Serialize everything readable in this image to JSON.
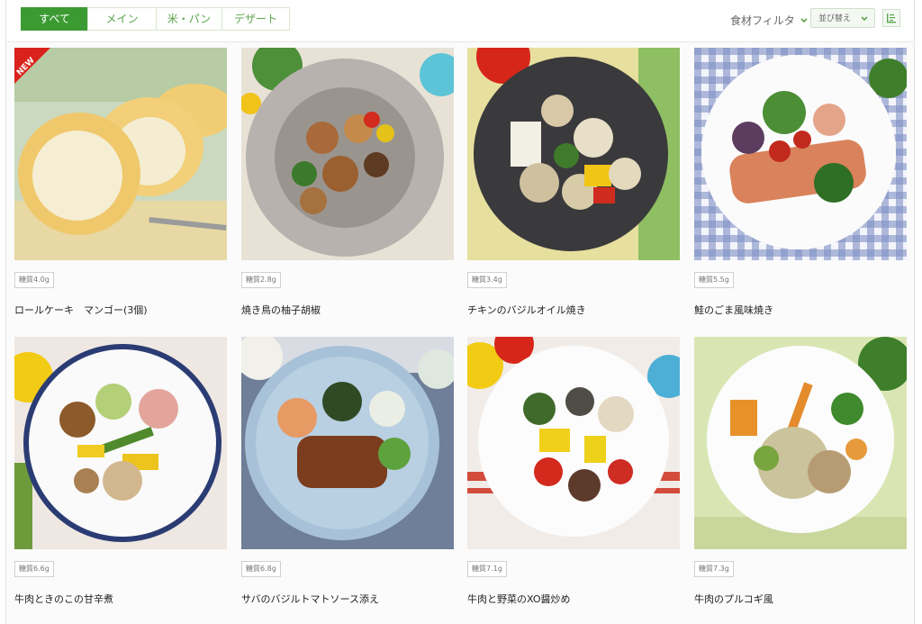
{
  "tabs": [
    {
      "label": "すべて",
      "active": true
    },
    {
      "label": "メイン",
      "active": false
    },
    {
      "label": "米・パン",
      "active": false
    },
    {
      "label": "デザート",
      "active": false
    }
  ],
  "filter": {
    "label": "食材フィルタ"
  },
  "sort": {
    "label": "並び替え"
  },
  "accent_color": "#3b9a32",
  "badge_color": "#d8221b",
  "products": [
    {
      "name": "ロールケーキ　マンゴー(3個)",
      "carb": "糖質4.0g",
      "badge": "NEW"
    },
    {
      "name": "焼き鳥の柚子胡椒",
      "carb": "糖質2.8g"
    },
    {
      "name": "チキンのバジルオイル焼き",
      "carb": "糖質3.4g"
    },
    {
      "name": "鮭のごま風味焼き",
      "carb": "糖質5.5g"
    },
    {
      "name": "牛肉ときのこの甘辛煮",
      "carb": "糖質6.6g"
    },
    {
      "name": "サバのバジルトマトソース添え",
      "carb": "糖質6.8g"
    },
    {
      "name": "牛肉と野菜のXO醤炒め",
      "carb": "糖質7.1g"
    },
    {
      "name": "牛肉のプルコギ風",
      "carb": "糖質7.3g"
    }
  ]
}
